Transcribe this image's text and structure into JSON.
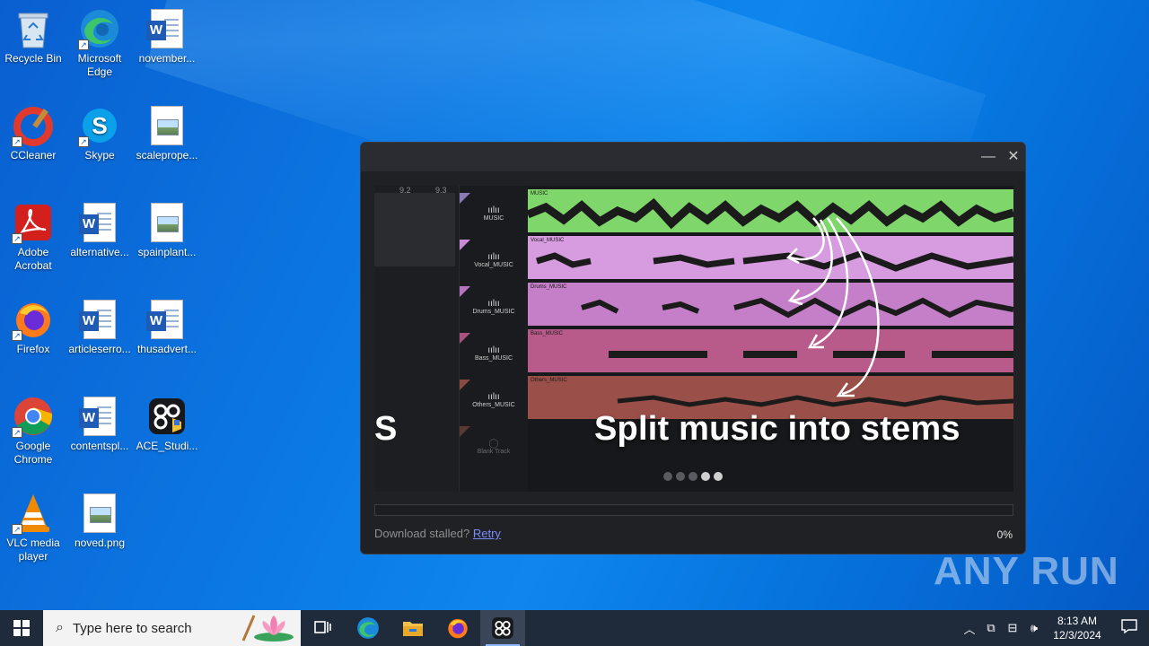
{
  "desktop": {
    "icons": [
      {
        "label": "Recycle Bin",
        "icon": "recycle-bin-icon"
      },
      {
        "label": "Microsoft Edge",
        "icon": "edge-icon"
      },
      {
        "label": "november...",
        "icon": "word-doc-icon"
      },
      {
        "label": "CCleaner",
        "icon": "ccleaner-icon"
      },
      {
        "label": "Skype",
        "icon": "skype-icon"
      },
      {
        "label": "scaleprope...",
        "icon": "image-file-icon"
      },
      {
        "label": "Adobe Acrobat",
        "icon": "acrobat-icon"
      },
      {
        "label": "alternative...",
        "icon": "word-doc-icon"
      },
      {
        "label": "spainplant...",
        "icon": "image-file-icon"
      },
      {
        "label": "Firefox",
        "icon": "firefox-icon"
      },
      {
        "label": "articleserro...",
        "icon": "word-doc-icon"
      },
      {
        "label": "thusadvert...",
        "icon": "word-doc-icon"
      },
      {
        "label": "Google Chrome",
        "icon": "chrome-icon"
      },
      {
        "label": "contentspl...",
        "icon": "word-doc-icon"
      },
      {
        "label": "ACE_Studi...",
        "icon": "ace-studio-icon"
      },
      {
        "label": "VLC media player",
        "icon": "vlc-icon"
      },
      {
        "label": "noved.png",
        "icon": "image-file-icon"
      }
    ]
  },
  "app": {
    "banner": {
      "ruler_marks": [
        "9.2",
        "9.3"
      ],
      "tracks": [
        {
          "name": "MUSIC",
          "lane_label": "MUSIC",
          "color": "#7fd66a"
        },
        {
          "name": "Vocal_MUSIC",
          "lane_label": "Vocal_MUSIC",
          "color": "#d79be0"
        },
        {
          "name": "Drums_MUSIC",
          "lane_label": "Drums_MUSIC",
          "color": "#c57fc8"
        },
        {
          "name": "Bass_MUSIC",
          "lane_label": "Bass_MUSIC",
          "color": "#b85a8a"
        },
        {
          "name": "Others_MUSIC",
          "lane_label": "Others_MUSIC",
          "color": "#9a5048"
        }
      ],
      "blank_track": "Blank Track",
      "left_fragment": "S",
      "headline": "Split music into stems",
      "dots_total": 5,
      "dots_active": [
        3,
        4
      ]
    },
    "progress_fraction": 0.0,
    "status_prefix": "Download stalled?",
    "retry_label": "Retry",
    "percent": "0%"
  },
  "watermark": "ANY RUN",
  "taskbar": {
    "search_placeholder": "Type here to search",
    "apps": [
      "task-view-icon",
      "edge-icon",
      "file-explorer-icon",
      "firefox-icon",
      "ace-studio-icon"
    ],
    "active_app": "ace-studio-icon",
    "time": "8:13 AM",
    "date": "12/3/2024"
  },
  "colors": {
    "accent": "#4a7cf0",
    "link": "#7b8cff",
    "taskbar": "#1f2a3a"
  }
}
